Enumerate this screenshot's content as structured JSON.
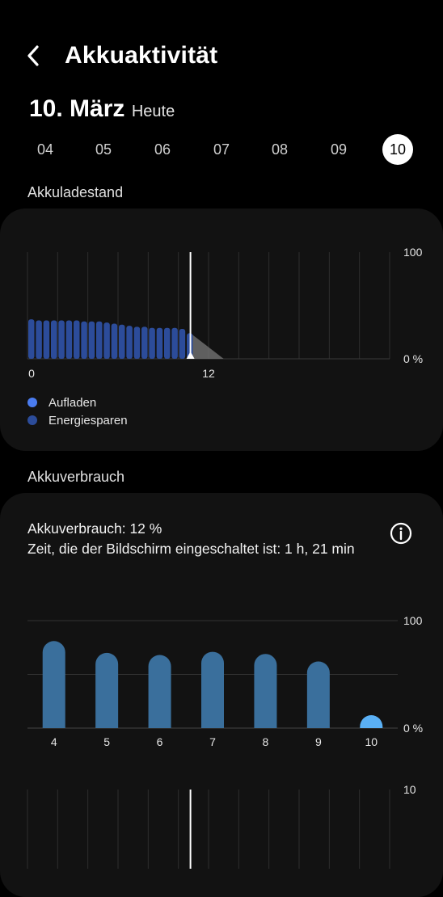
{
  "header": {
    "title": "Akkuaktivität",
    "back_icon": "chevron-left-icon"
  },
  "date": {
    "main": "10. März",
    "sub": "Heute"
  },
  "days": [
    {
      "label": "04",
      "selected": false
    },
    {
      "label": "05",
      "selected": false
    },
    {
      "label": "06",
      "selected": false
    },
    {
      "label": "07",
      "selected": false
    },
    {
      "label": "08",
      "selected": false
    },
    {
      "label": "09",
      "selected": false
    },
    {
      "label": "10",
      "selected": true
    }
  ],
  "battery_level": {
    "section_label": "Akkuladestand",
    "legend": [
      {
        "label": "Aufladen",
        "color": "#4a7cf0"
      },
      {
        "label": "Energiesparen",
        "color": "#2c4c9a"
      }
    ]
  },
  "usage": {
    "section_label": "Akkuverbrauch",
    "line1": "Akkuverbrauch: 12 %",
    "line2": "Zeit, die der Bildschirm eingeschaltet ist: 1 h, 21 min",
    "info_icon": "info-icon"
  },
  "chart_data": [
    {
      "type": "bar",
      "x_tick_labels": [
        "0",
        "12"
      ],
      "y_tick_labels": [
        "100",
        "0 %"
      ],
      "ylim": [
        0,
        100
      ],
      "x_range_hours": [
        0,
        24
      ],
      "hours": [
        0,
        0.5,
        1,
        1.5,
        2,
        2.5,
        3,
        3.5,
        4,
        4.5,
        5,
        5.5,
        6,
        6.5,
        7,
        7.5,
        8,
        8.5,
        9,
        9.5,
        10,
        10.5
      ],
      "values": [
        37,
        36,
        36,
        36,
        36,
        36,
        36,
        35,
        35,
        35,
        34,
        33,
        32,
        31,
        30,
        30,
        29,
        29,
        29,
        29,
        28,
        24
      ],
      "projected": {
        "from_hour": 10.8,
        "from_value": 24,
        "to_hour": 13,
        "to_value": 0
      },
      "current_hour": 10.8,
      "bar_color": "#2c4c9a"
    },
    {
      "type": "bar",
      "categories": [
        "4",
        "5",
        "6",
        "7",
        "8",
        "9",
        "10"
      ],
      "values": [
        81,
        70,
        68,
        71,
        69,
        62,
        12
      ],
      "y_tick_labels": [
        "100",
        "0 %"
      ],
      "ylim": [
        0,
        100
      ],
      "colors": [
        "#3a6f9c",
        "#3a6f9c",
        "#3a6f9c",
        "#3a6f9c",
        "#3a6f9c",
        "#3a6f9c",
        "#5ab0f5"
      ]
    },
    {
      "type": "bar",
      "y_tick_labels": [
        "10"
      ],
      "current_hour": 10.8
    }
  ]
}
